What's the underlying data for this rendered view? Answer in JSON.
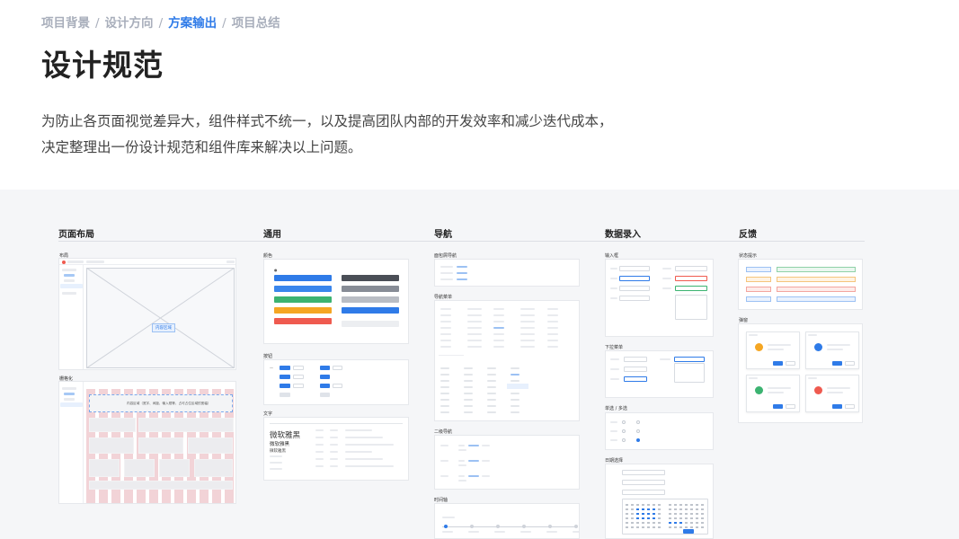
{
  "breadcrumb": {
    "items": [
      "项目背景",
      "设计方向",
      "方案输出",
      "项目总结"
    ],
    "separator": "/",
    "active_index": 2
  },
  "page_title": "设计规范",
  "intro": {
    "line1": "为防止各页面视觉差异大，组件样式不统一，以及提高团队内部的开发效率和减少迭代成本，",
    "line2": "决定整理出一份设计规范和组件库来解决以上问题。"
  },
  "columns": {
    "layout": "页面布局",
    "general": "通用",
    "navigation": "导航",
    "data_entry": "数据录入",
    "feedback": "反馈"
  },
  "layout_section": {
    "sub1": "布局",
    "content_area": "内容区域",
    "sub2": "栅格化",
    "grid_caption": "内容区域（宽字、间距、输入框等，占可占位区域的宽幅）"
  },
  "general_section": {
    "sub_color": "颜色",
    "sub_button": "按钮",
    "sub_text": "文字",
    "font_name": "微软雅黑"
  },
  "nav_section": {
    "sub1": "面包屑导航",
    "sub2": "导航菜单",
    "sub3": "二级导航",
    "sub4": "时间轴"
  },
  "entry_section": {
    "sub1": "输入框",
    "sub2": "下拉菜单",
    "sub3": "单选 / 多选",
    "sub4": "日期选择"
  },
  "feedback_section": {
    "sub1": "状态提示",
    "sub2": "弹窗"
  },
  "colors": {
    "accent": "#2f7be8",
    "board_bg": "#f5f6f8",
    "crumb_inactive": "#a8aebb",
    "green": "#3cb371",
    "orange": "#f5a623",
    "red": "#ef5a4f",
    "dark": "#5a5e66",
    "grid_pink": "#f2d3d7"
  }
}
